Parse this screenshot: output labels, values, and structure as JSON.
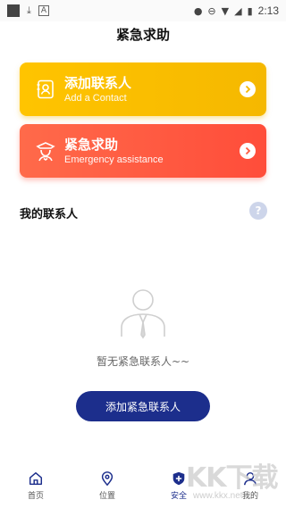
{
  "status_bar": {
    "time": "2:13",
    "icons": [
      "square-icon",
      "download-icon",
      "a-icon",
      "location-icon",
      "dnd-icon",
      "wifi-icon",
      "signal-icon",
      "battery-icon"
    ]
  },
  "page": {
    "title": "紧急求助"
  },
  "cards": [
    {
      "title": "添加联系人",
      "subtitle": "Add a Contact",
      "icon": "contact-card-icon",
      "color": "#ffc400"
    },
    {
      "title": "紧急求助",
      "subtitle": "Emergency assistance",
      "icon": "police-icon",
      "color": "#ff5a40"
    }
  ],
  "contacts": {
    "heading": "我的联系人",
    "help_icon": "?",
    "empty_text": "暂无紧急联系人~~",
    "add_button": "添加紧急联系人"
  },
  "tabbar": {
    "items": [
      {
        "label": "首页",
        "icon": "home-icon"
      },
      {
        "label": "位置",
        "icon": "location-pin-icon"
      },
      {
        "label": "安全",
        "icon": "shield-plus-icon",
        "active": true
      },
      {
        "label": "我的",
        "icon": "user-icon"
      }
    ]
  },
  "watermark": {
    "main": "KK下载",
    "sub": "www.kkx.net"
  },
  "colors": {
    "primary": "#1c2e8c",
    "yellow": "#ffc400",
    "red": "#ff5a40",
    "help": "#cdd5ea"
  }
}
